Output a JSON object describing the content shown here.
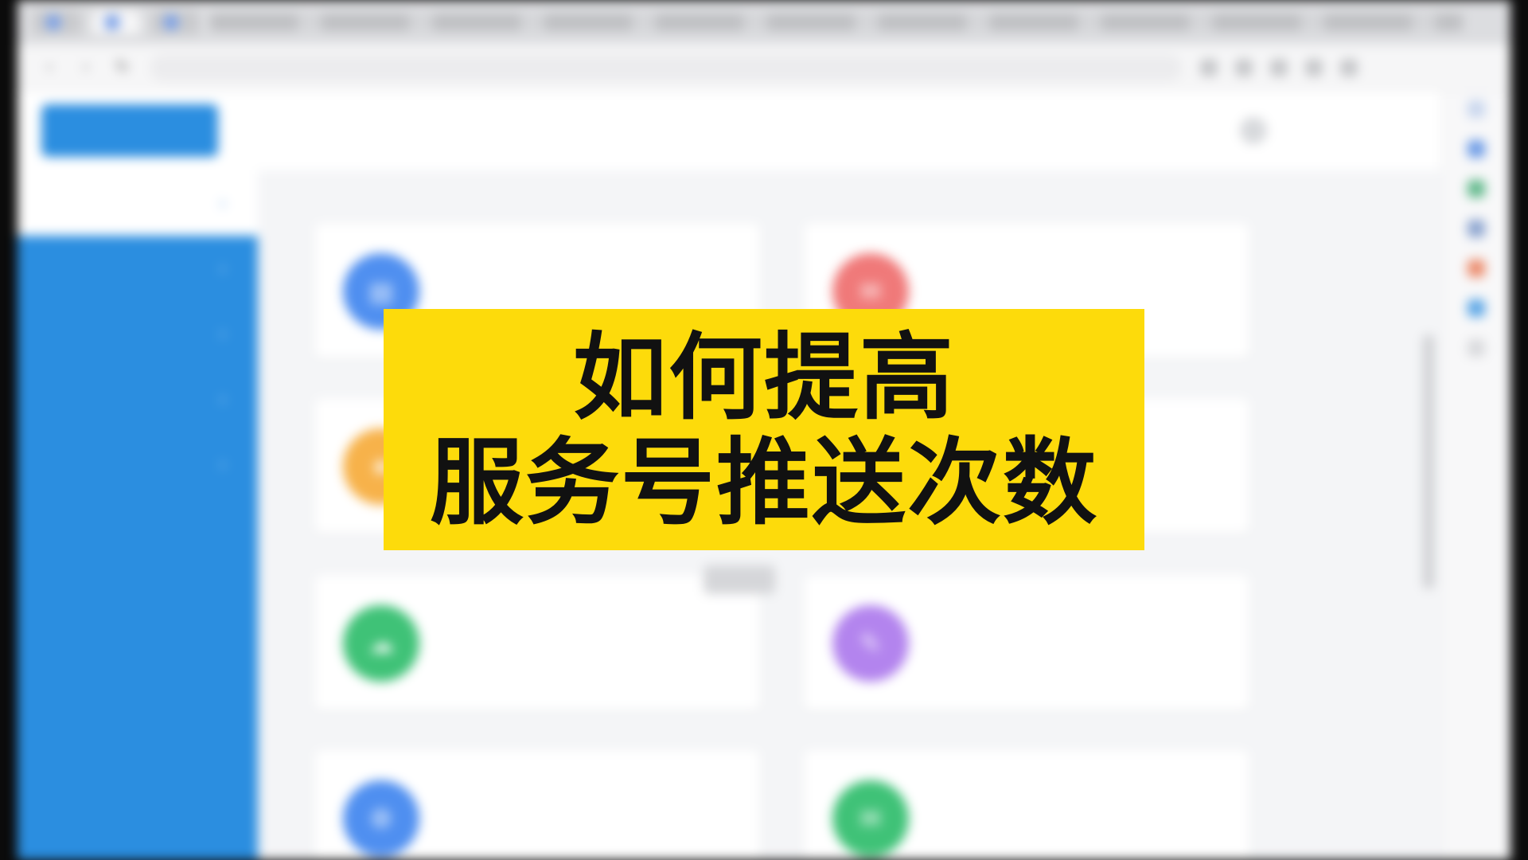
{
  "overlay": {
    "line1": "如何提高",
    "line2": "服务号推送次数"
  },
  "browser": {
    "tabs": [
      "",
      "",
      ""
    ],
    "url": "",
    "nav": {
      "back_icon": "arrow-left-icon",
      "forward_icon": "arrow-right-icon",
      "reload_icon": "reload-icon"
    }
  },
  "header": {
    "logo_label": "",
    "links": [
      "",
      "",
      "",
      ""
    ]
  },
  "sidebar": {
    "top_item": "",
    "items": [
      "",
      "",
      "",
      ""
    ]
  },
  "cards": [
    {
      "title": "",
      "tag": "",
      "desc": "",
      "icon_color": "#4f8ff0",
      "icon": "document-icon"
    },
    {
      "title": "",
      "tag": "",
      "desc": "",
      "icon_color": "#f07979",
      "icon": "message-icon"
    },
    {
      "title": "",
      "tag": "",
      "desc": "",
      "icon_color": "#f7b24a",
      "icon": "star-icon"
    },
    {
      "title": "",
      "tag": "",
      "desc": "",
      "icon_color": "#fafafa",
      "icon": "blank-icon"
    },
    {
      "title": "",
      "tag": "",
      "desc": "",
      "icon_color": "#3fc277",
      "icon": "cloud-icon"
    },
    {
      "title": "",
      "tag": "",
      "desc": "",
      "icon_color": "#b384ee",
      "icon": "chat-icon"
    },
    {
      "title": "",
      "tag": "",
      "desc": "",
      "icon_color": "#4f8ff0",
      "icon": "gear-icon"
    },
    {
      "title": "",
      "tag": "",
      "desc": "",
      "icon_color": "#3fc277",
      "icon": "mail-icon"
    }
  ],
  "colors": {
    "banner": "#fddb0b",
    "sidebar": "#2b8ee0",
    "accent_link": "#3d8fe4"
  }
}
